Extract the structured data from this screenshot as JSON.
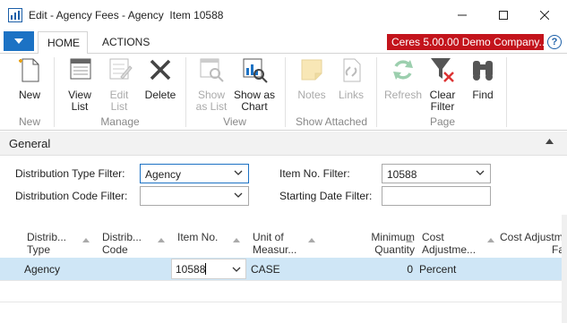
{
  "window": {
    "title": "Edit - Agency Fees - Agency  Item 10588",
    "minimize_symbol": "—",
    "maximize_symbol": "☐",
    "close_symbol": "✕"
  },
  "ribbon_tabs": {
    "home": "HOME",
    "actions": "ACTIONS",
    "company": "Ceres 5.00.00 Demo Company..."
  },
  "ribbon": {
    "new": {
      "group": "New",
      "buttons": [
        {
          "label": "New",
          "icon": "new-document-icon"
        }
      ]
    },
    "manage": {
      "group": "Manage",
      "buttons": [
        {
          "label": "View\nList",
          "icon": "view-list-icon"
        },
        {
          "label": "Edit\nList",
          "icon": "edit-list-icon"
        },
        {
          "label": "Delete",
          "icon": "delete-icon"
        }
      ]
    },
    "view": {
      "group": "View",
      "buttons": [
        {
          "label": "Show\nas List",
          "icon": "show-as-list-icon"
        },
        {
          "label": "Show as\nChart",
          "icon": "show-as-chart-icon"
        }
      ]
    },
    "show_attached": {
      "group": "Show Attached",
      "buttons": [
        {
          "label": "Notes",
          "icon": "notes-icon"
        },
        {
          "label": "Links",
          "icon": "links-icon"
        }
      ]
    },
    "page": {
      "group": "Page",
      "buttons": [
        {
          "label": "Refresh",
          "icon": "refresh-icon"
        },
        {
          "label": "Clear\nFilter",
          "icon": "clear-filter-icon"
        },
        {
          "label": "Find",
          "icon": "find-binoculars-icon"
        }
      ]
    }
  },
  "fasttab": {
    "title": "General"
  },
  "filters": {
    "distribution_type": {
      "label": "Distribution Type Filter:",
      "value": "Agency"
    },
    "distribution_code": {
      "label": "Distribution Code Filter:",
      "value": ""
    },
    "item_no": {
      "label": "Item No. Filter:",
      "value": "10588"
    },
    "starting_date": {
      "label": "Starting Date Filter:",
      "value": ""
    }
  },
  "grid": {
    "columns": [
      {
        "line1": "Distrib...",
        "line2": "Type"
      },
      {
        "line1": "Distrib...",
        "line2": "Code"
      },
      {
        "line1": "Item No.",
        "line2": ""
      },
      {
        "line1": "Unit of",
        "line2": "Measur..."
      },
      {
        "line1": "Minimum",
        "line2": "Quantity"
      },
      {
        "line1": "Cost",
        "line2": "Adjustme..."
      },
      {
        "line1": "Cost Adjustm",
        "line2": "Fa"
      }
    ],
    "rows": [
      {
        "type": "Agency",
        "code": "",
        "item_no": "10588",
        "uom": "CASE",
        "min_qty": "0",
        "cost_adj": "Percent"
      }
    ]
  },
  "colors": {
    "accent": "#1c72c4",
    "company_bg": "#c3141c",
    "selected_row": "#cfe6f6"
  }
}
